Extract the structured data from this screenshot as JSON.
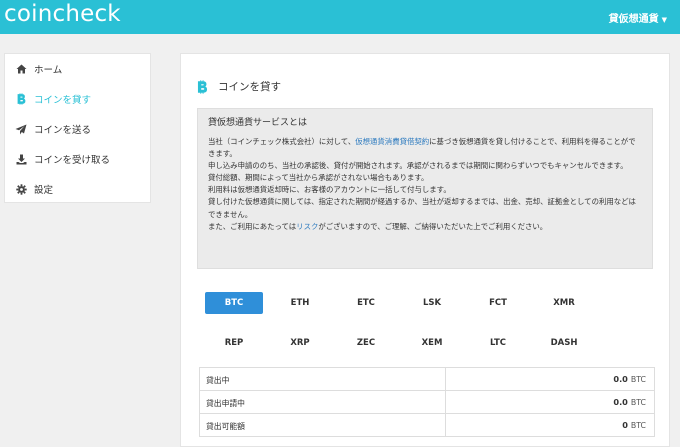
{
  "app": {
    "logo": "coincheck",
    "account_label": "貸仮想通貨",
    "caret": "▼"
  },
  "sidebar": {
    "items": [
      {
        "label": "ホーム",
        "icon": "home-icon",
        "active": false
      },
      {
        "label": "コインを貸す",
        "icon": "bitcoin-icon",
        "active": true
      },
      {
        "label": "コインを送る",
        "icon": "paper-plane-icon",
        "active": false
      },
      {
        "label": "コインを受け取る",
        "icon": "download-icon",
        "active": false
      },
      {
        "label": "設定",
        "icon": "gear-icon",
        "active": false
      }
    ]
  },
  "main": {
    "title": "コインを貸す",
    "info": {
      "title": "貸仮想通貨サービスとは",
      "p1_pre": "当社（コインチェック株式会社）に対して、",
      "p1_link": "仮想通貨消費貸借契約",
      "p1_post": "に基づき仮想通貨を貸し付けることで、利用料を得ることができます。",
      "p2": "申し込み申請ののち、当社の承認後、貸付が開始されます。承認がされるまでは期間に関わらずいつでもキャンセルできます。",
      "p3": "貸付総額、期間によって当社から承認がされない場合もあります。",
      "p4": "利用料は仮想通貨返却時に、お客様のアカウントに一括して付与します。",
      "p5": "貸し付けた仮想通貨に関しては、指定された期間が経過するか、当社が返却するまでは、出金、売却、証拠金としての利用などはできません。",
      "p6_pre": "また、ご利用にあたっては",
      "p6_link": "リスク",
      "p6_post": "がございますので、ご理解、ご納得いただいた上でご利用ください。"
    },
    "coins": [
      "BTC",
      "ETH",
      "ETC",
      "LSK",
      "FCT",
      "XMR",
      "REP",
      "XRP",
      "ZEC",
      "XEM",
      "LTC",
      "DASH"
    ],
    "selected_coin": "BTC",
    "stats": [
      {
        "label": "貸出中",
        "value": "0.0",
        "unit": "BTC"
      },
      {
        "label": "貸出申請中",
        "value": "0.0",
        "unit": "BTC"
      },
      {
        "label": "貸出可能額",
        "value": "0",
        "unit": "BTC"
      }
    ]
  },
  "colors": {
    "brand": "#2ac0d5",
    "active_coin": "#2f8fd9",
    "link": "#2e7bbf",
    "bitcoin": "#2ac0d5"
  }
}
